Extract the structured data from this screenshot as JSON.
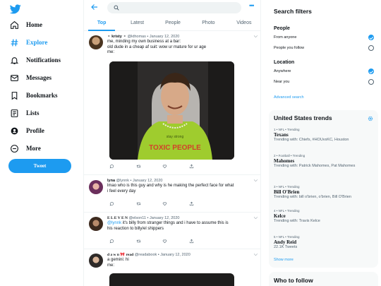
{
  "nav": {
    "items": [
      {
        "label": "Home",
        "icon": "home-icon"
      },
      {
        "label": "Explore",
        "icon": "hashtag-icon"
      },
      {
        "label": "Notifications",
        "icon": "bell-icon"
      },
      {
        "label": "Messages",
        "icon": "envelope-icon"
      },
      {
        "label": "Bookmarks",
        "icon": "bookmark-icon"
      },
      {
        "label": "Lists",
        "icon": "list-icon"
      },
      {
        "label": "Profile",
        "icon": "profile-icon"
      },
      {
        "label": "More",
        "icon": "more-icon"
      }
    ],
    "tweet_button": "Tweet"
  },
  "header": {
    "tabs": [
      "Top",
      "Latest",
      "People",
      "Photo",
      "Videos"
    ],
    "active_tab": "Top",
    "more": "•••"
  },
  "tweets": [
    {
      "name": "⚬ kristy ⚬",
      "handle": "@kthomas",
      "date": "January 12, 2020",
      "text": [
        "me, minding my own business at a bar:",
        "old dude in a cheap af suit: wow ur mature for ur age",
        "me:"
      ],
      "media": "gif",
      "media_caption": [
        "stay strong",
        "TOXIC PEOPLE"
      ]
    },
    {
      "name": "lyna",
      "handle": "@lynnk",
      "date": "January 12, 2020",
      "text": [
        "lmao who is this guy and why is he making the perfect face for what",
        "i feel every day"
      ]
    },
    {
      "name": "E L E V E N",
      "handle": "@elson11",
      "date": "January 12, 2020",
      "text_mention": "@lynnk",
      "text": [
        "it's billy from stranger things and i have to assume this is",
        "his reaction to billy/el shippers"
      ]
    },
    {
      "name": "d a w n 🎀 read",
      "handle": "@readabook",
      "date": "January 12, 2020",
      "text": [
        "a gemini: hi",
        "me:"
      ]
    }
  ],
  "separator": "•",
  "search_filters": {
    "title": "Search filters",
    "people_label": "People",
    "people_options": [
      "From anyone",
      "People you follow"
    ],
    "location_label": "Location",
    "location_options": [
      "Anywhere",
      "Near you"
    ],
    "advanced": "Advanced search"
  },
  "trends": {
    "title": "United States trends",
    "items": [
      {
        "meta": "1 • NFL • Trending",
        "name": "Texans",
        "sub": "Trending with: Chiefs, #HOUvsKC, Houston"
      },
      {
        "meta": "2 • Football • Trending",
        "name": "Mahomes",
        "sub": "Trending with: Patrick Mahomes, Pat Mahomes"
      },
      {
        "meta": "3 • NFL • Trending",
        "name": "Bill O'Brien",
        "sub": "Trending with: bill o'brien, o'brien, Bill O'Brien"
      },
      {
        "meta": "4 • NFL • Trending",
        "name": "Kelce",
        "sub": "Trending with: Travis Kelce"
      },
      {
        "meta": "5 • NFL • Trending",
        "name": "Andy Reid",
        "sub": "22.1K Tweets"
      }
    ],
    "show_more": "Show more"
  },
  "who_to_follow": {
    "title": "Who to follow"
  },
  "colors": {
    "accent": "#1d9bf0",
    "text": "#0f1419",
    "secondary": "#536471",
    "panel": "#f7f9f9"
  }
}
